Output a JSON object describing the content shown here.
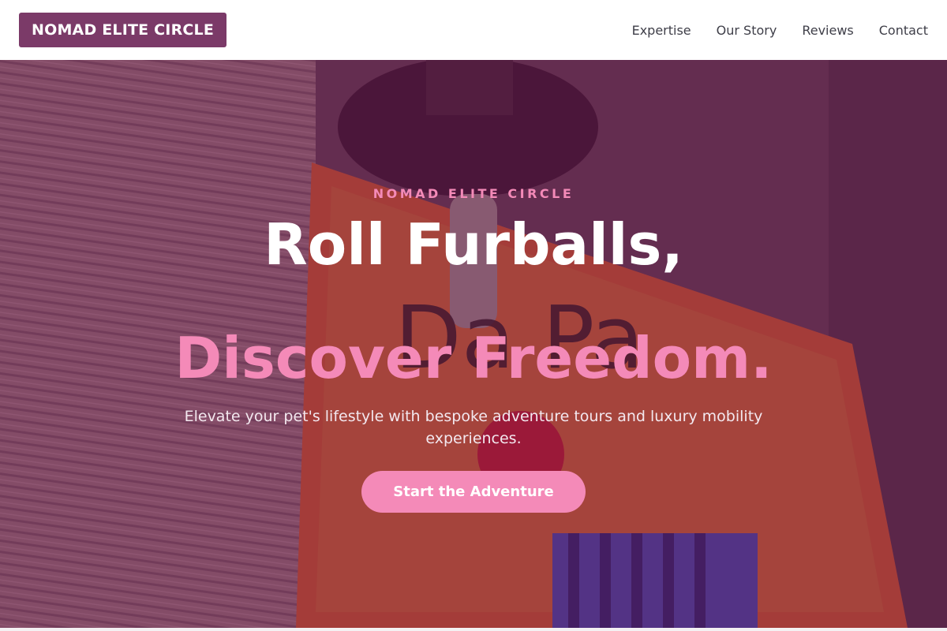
{
  "header": {
    "logo": "NOMAD ELITE CIRCLE",
    "nav": [
      {
        "label": "Expertise"
      },
      {
        "label": "Our Story"
      },
      {
        "label": "Reviews"
      },
      {
        "label": "Contact"
      }
    ]
  },
  "hero": {
    "eyebrow": "NOMAD ELITE CIRCLE",
    "headline_line1": "Roll Furballs,",
    "headline_line2": "Discover Freedom.",
    "subtitle": "Elevate your pet's lifestyle with bespoke adventure tours and luxury mobility experiences.",
    "cta_label": "Start the Adventure",
    "background_icon": "dog-parking-sign-photo"
  },
  "colors": {
    "brand": "#7b3a68",
    "accent_pink": "#f48ab8",
    "overlay": "#5c1446"
  }
}
